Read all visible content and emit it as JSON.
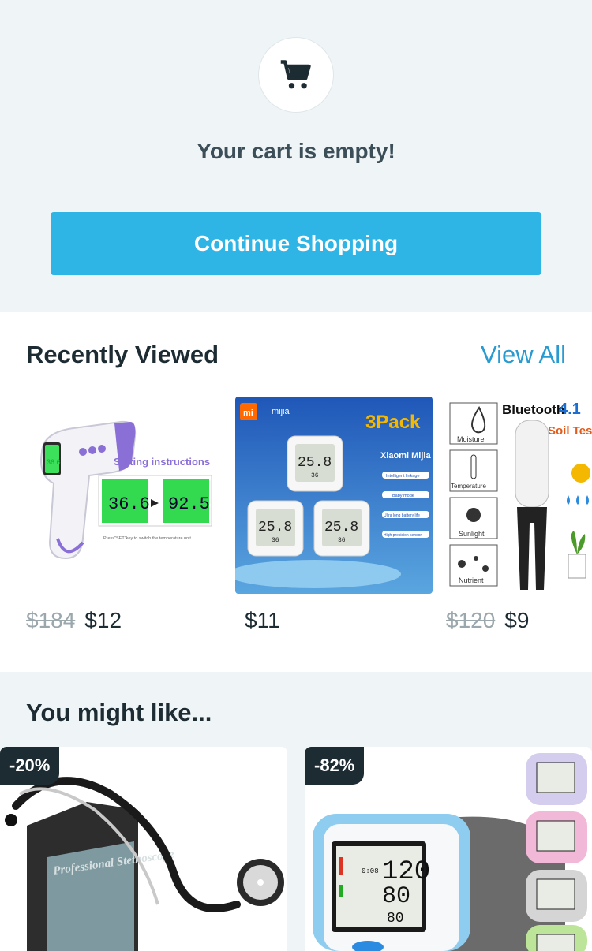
{
  "empty_cart": {
    "icon": "cart-icon",
    "title": "Your cart is empty!",
    "button_label": "Continue Shopping",
    "accent_color": "#2fb4e6"
  },
  "recently_viewed": {
    "title": "Recently Viewed",
    "view_all_label": "View All",
    "items": [
      {
        "image": "thermometer-product-image",
        "image_text": {
          "heading": "Setting instructions",
          "reading1": "36.6",
          "reading2": "92.5",
          "footnote": "Press\"SET\"key to switch the temperature unit"
        },
        "old_price": "$184",
        "price": "$12"
      },
      {
        "image": "hygrometer-product-image",
        "image_text": {
          "brand": "mijia",
          "badge": "3Pack",
          "product": "Xiaomi Mijia",
          "features": [
            "Intelligent linkage",
            "Baby mode",
            "Ultra long battery life",
            "High precision sensor"
          ],
          "reading": "25.8",
          "humidity": "36"
        },
        "old_price": "",
        "price": "$11"
      },
      {
        "image": "soil-tester-product-image",
        "image_text": {
          "heading": "Bluetooth",
          "version": "4.1",
          "subheading": "Soil Test",
          "labels": [
            "Moisture",
            "Temperature",
            "Sunlight",
            "Nutrient"
          ]
        },
        "old_price": "$120",
        "price": "$9"
      }
    ]
  },
  "recommendations": {
    "title": "You might like...",
    "items": [
      {
        "discount": "-20%",
        "image": "stethoscope-product-image",
        "image_text": "Professional Stethoscope"
      },
      {
        "discount": "-82%",
        "image": "blood-pressure-monitor-product-image",
        "image_text": {
          "sys": "120",
          "dia": "80",
          "pulse": "80",
          "time": "0:08"
        }
      }
    ]
  }
}
